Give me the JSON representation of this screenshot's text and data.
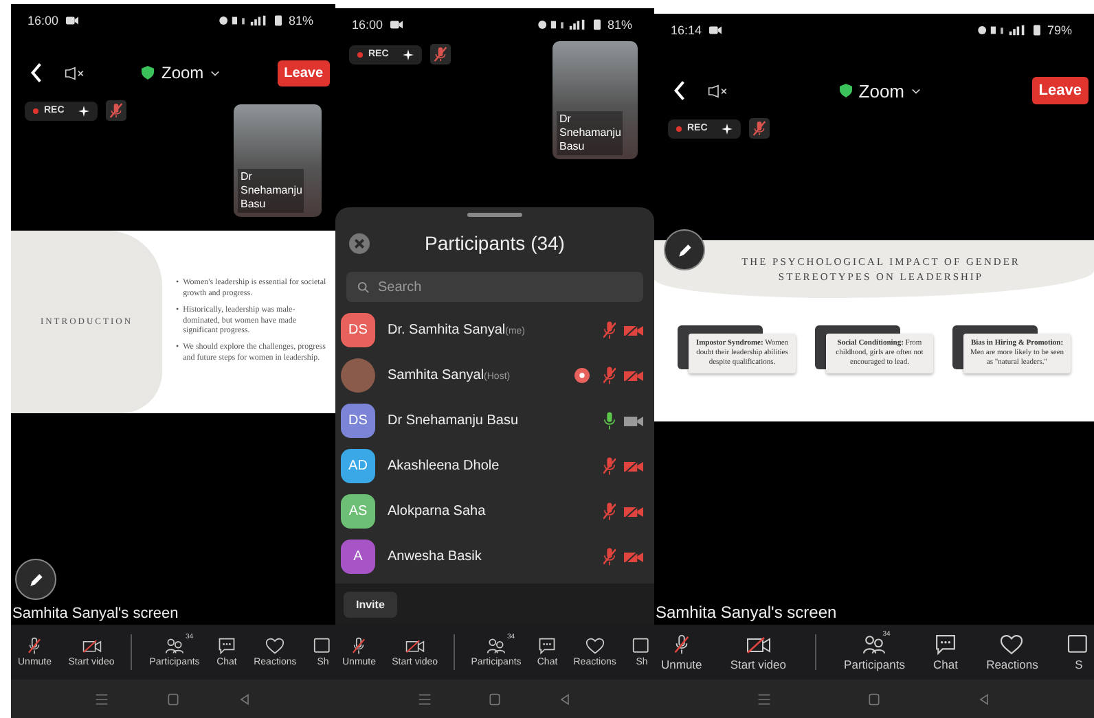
{
  "screens": [
    {
      "kind": "meeting",
      "status": {
        "time": "16:00",
        "battery": "81%"
      },
      "top_bar": {
        "title": "Zoom",
        "leave": "Leave"
      },
      "rec": "REC",
      "tile": {
        "name": "Dr Snehamanju Basu"
      },
      "slide": {
        "kind": "intro",
        "title": "INTRODUCTION",
        "marker": "•",
        "bullets": [
          "Women's leadership is essential for societal growth and progress.",
          "Historically, leadership was male-dominated, but women have made significant progress.",
          "We should explore the challenges, progress and future steps for women in leadership."
        ]
      },
      "share_label": "Samhita Sanyal's screen",
      "toolbar": [
        {
          "kind": "mic",
          "label": "Unmute"
        },
        {
          "kind": "video",
          "label": "Start video"
        },
        {
          "kind": "people",
          "label": "Participants",
          "badge": "34"
        },
        {
          "kind": "chat",
          "label": "Chat"
        },
        {
          "kind": "reactions",
          "label": "Reactions"
        },
        {
          "kind": "share",
          "label": "Sh"
        }
      ]
    },
    {
      "kind": "participants",
      "status": {
        "time": "16:00",
        "battery": "81%"
      },
      "rec": "REC",
      "tile": {
        "name": "Dr Snehamanju Basu"
      },
      "sheet": {
        "title": "Participants (34)",
        "search": {
          "placeholder": "Search"
        },
        "invite": "Invite",
        "people": [
          {
            "name": "Dr. Samhita Sanyal",
            "tag": "(me)",
            "kind": "initials",
            "initials": "DS",
            "color": "#e8625d",
            "muted": true,
            "video_off": true,
            "recording": false
          },
          {
            "name": "Samhita Sanyal",
            "tag": "(Host)",
            "kind": "photo",
            "color": "#8a5a4a",
            "muted": true,
            "video_off": true,
            "recording": true
          },
          {
            "name": "Dr Snehamanju Basu",
            "kind": "initials",
            "initials": "DS",
            "color": "#7b84d6",
            "muted": false,
            "video_off": false,
            "recording": false
          },
          {
            "name": "Akashleena Dhole",
            "kind": "initials",
            "initials": "AD",
            "color": "#3aa8e6",
            "muted": true,
            "video_off": true,
            "recording": false
          },
          {
            "name": "Alokparna Saha",
            "kind": "initials",
            "initials": "AS",
            "color": "#6cbf74",
            "muted": true,
            "video_off": true,
            "recording": false
          },
          {
            "name": "Anwesha Basik",
            "kind": "initials",
            "initials": "A",
            "color": "#a754c6",
            "muted": true,
            "video_off": true,
            "recording": false
          }
        ]
      },
      "toolbar": [
        {
          "kind": "mic",
          "label": "Unmute"
        },
        {
          "kind": "video",
          "label": "Start video"
        },
        {
          "kind": "people",
          "label": "Participants",
          "badge": "34"
        },
        {
          "kind": "chat",
          "label": "Chat"
        },
        {
          "kind": "reactions",
          "label": "Reactions"
        },
        {
          "kind": "share",
          "label": "Sh"
        }
      ]
    },
    {
      "kind": "meeting",
      "status": {
        "time": "16:14",
        "battery": "79%"
      },
      "top_bar": {
        "title": "Zoom",
        "leave": "Leave"
      },
      "rec": "REC",
      "slide": {
        "kind": "cards",
        "title": "THE PSYCHOLOGICAL IMPACT OF GENDER STEREOTYPES ON LEADERSHIP",
        "cards": [
          "**Impostor Syndrome:** Women doubt their leadership abilities despite qualifications.",
          "**Social Conditioning:** From childhood, girls are often not encouraged to lead.",
          "**Bias in Hiring & Promotion:** Men are more likely to be seen as \"natural leaders.\""
        ]
      },
      "share_label": "Samhita Sanyal's screen",
      "toolbar": [
        {
          "kind": "mic",
          "label": "Unmute"
        },
        {
          "kind": "video",
          "label": "Start video"
        },
        {
          "kind": "people",
          "label": "Participants",
          "badge": "34"
        },
        {
          "kind": "chat",
          "label": "Chat"
        },
        {
          "kind": "reactions",
          "label": "Reactions"
        },
        {
          "kind": "share",
          "label": "S"
        }
      ]
    }
  ]
}
